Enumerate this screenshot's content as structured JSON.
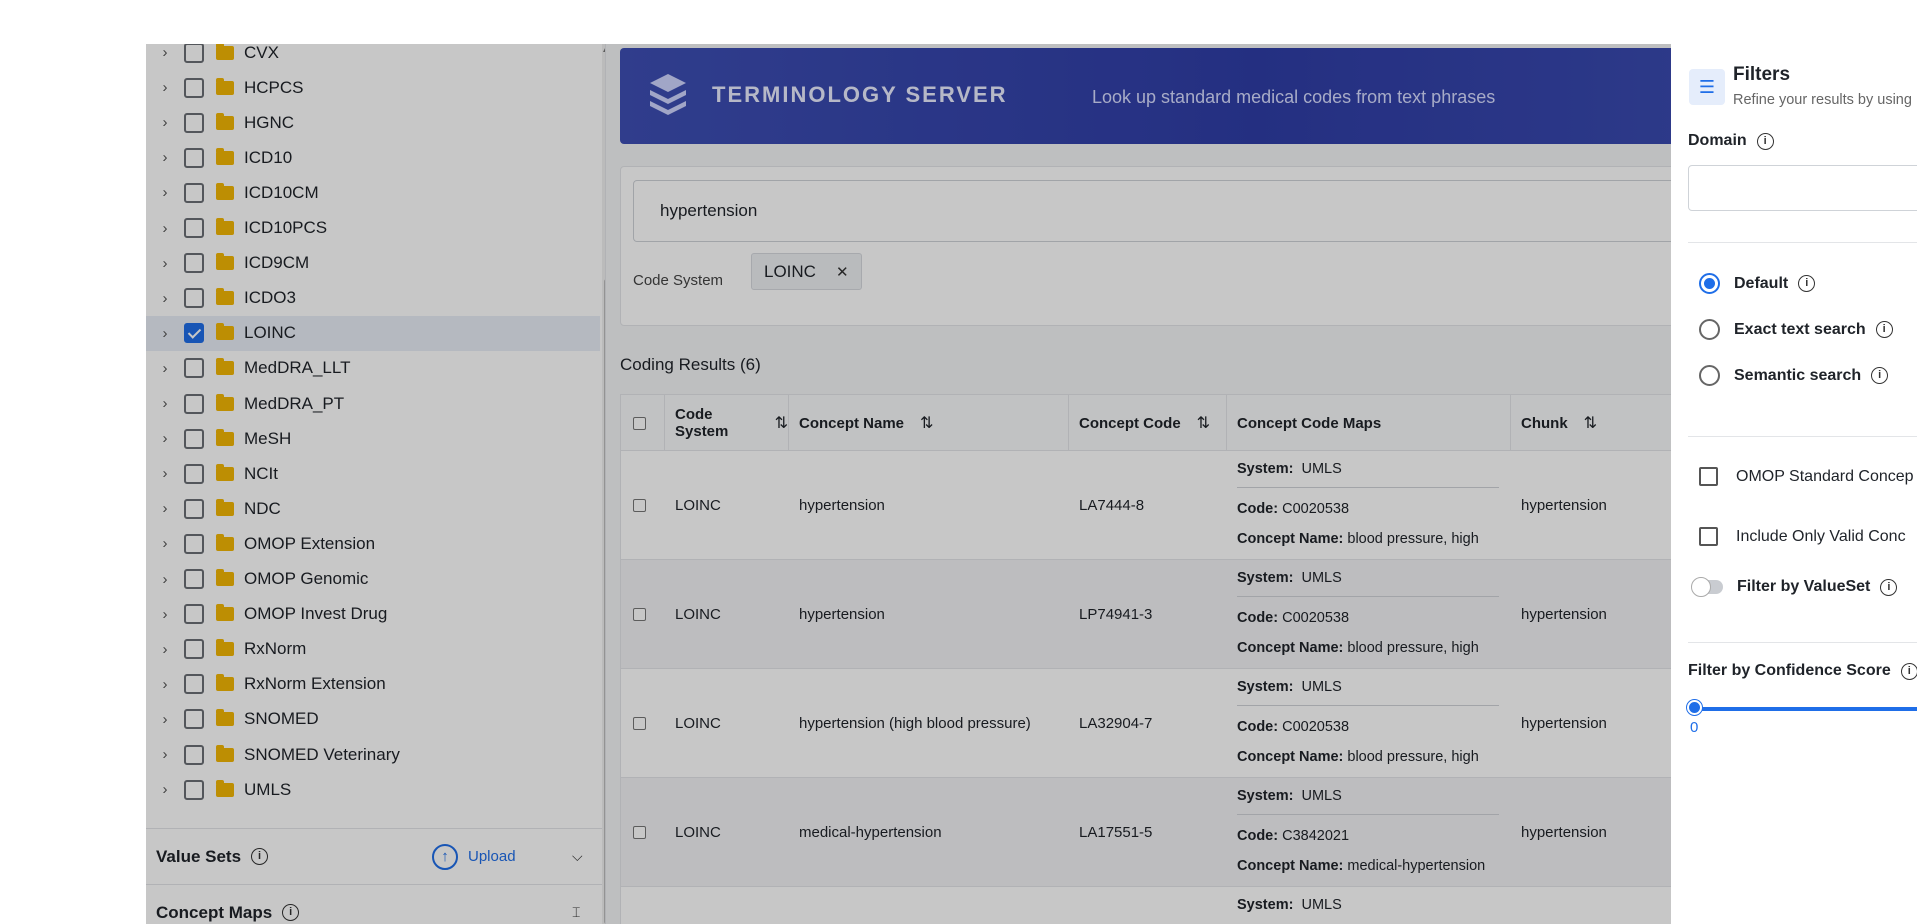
{
  "tree": {
    "items": [
      {
        "label": "CVX",
        "checked": false
      },
      {
        "label": "HCPCS",
        "checked": false
      },
      {
        "label": "HGNC",
        "checked": false
      },
      {
        "label": "ICD10",
        "checked": false
      },
      {
        "label": "ICD10CM",
        "checked": false
      },
      {
        "label": "ICD10PCS",
        "checked": false
      },
      {
        "label": "ICD9CM",
        "checked": false
      },
      {
        "label": "ICDO3",
        "checked": false
      },
      {
        "label": "LOINC",
        "checked": true
      },
      {
        "label": "MedDRA_LLT",
        "checked": false
      },
      {
        "label": "MedDRA_PT",
        "checked": false
      },
      {
        "label": "MeSH",
        "checked": false
      },
      {
        "label": "NCIt",
        "checked": false
      },
      {
        "label": "NDC",
        "checked": false
      },
      {
        "label": "OMOP Extension",
        "checked": false
      },
      {
        "label": "OMOP Genomic",
        "checked": false
      },
      {
        "label": "OMOP Invest Drug",
        "checked": false
      },
      {
        "label": "RxNorm",
        "checked": false
      },
      {
        "label": "RxNorm Extension",
        "checked": false
      },
      {
        "label": "SNOMED",
        "checked": false
      },
      {
        "label": "SNOMED Veterinary",
        "checked": false
      },
      {
        "label": "UMLS",
        "checked": false
      }
    ],
    "value_sets": {
      "title": "Value Sets",
      "upload": "Upload"
    },
    "concept_maps": {
      "title": "Concept Maps"
    },
    "partial_item": "LOINC"
  },
  "banner": {
    "title": "TERMINOLOGY SERVER",
    "subtitle": "Look up standard medical codes from text phrases"
  },
  "search": {
    "value": "hypertension",
    "code_system_label": "Code System",
    "chip": "LOINC"
  },
  "results": {
    "title": "Coding Results (6)",
    "headers": {
      "code_system": "Code System",
      "concept_name": "Concept Name",
      "concept_code": "Concept Code",
      "maps": "Concept Code Maps",
      "chunk": "Chunk"
    },
    "map_labels": {
      "system": "System:",
      "code": "Code:",
      "concept_name": "Concept Name:"
    },
    "rows": [
      {
        "code_system": "LOINC",
        "concept_name": "hypertension",
        "concept_code": "LA7444-8",
        "map_system": "UMLS",
        "map_code": "C0020538",
        "map_name": "blood pressure, high",
        "chunk": "hypertension"
      },
      {
        "code_system": "LOINC",
        "concept_name": "hypertension",
        "concept_code": "LP74941-3",
        "map_system": "UMLS",
        "map_code": "C0020538",
        "map_name": "blood pressure, high",
        "chunk": "hypertension"
      },
      {
        "code_system": "LOINC",
        "concept_name": "hypertension (high blood pressure)",
        "concept_code": "LA32904-7",
        "map_system": "UMLS",
        "map_code": "C0020538",
        "map_name": "blood pressure, high",
        "chunk": "hypertension"
      },
      {
        "code_system": "LOINC",
        "concept_name": "medical-hypertension",
        "concept_code": "LA17551-5",
        "map_system": "UMLS",
        "map_code": "C3842021",
        "map_name": "medical-hypertension",
        "chunk": "hypertension"
      }
    ],
    "partial_map_system": "UMLS"
  },
  "filters": {
    "title": "Filters",
    "subtitle": "Refine your results by using",
    "domain_label": "Domain",
    "search_modes": [
      "Default",
      "Exact text search",
      "Semantic search"
    ],
    "selected_mode": "Default",
    "omop_label": "OMOP Standard Concep",
    "valid_label": "Include Only Valid Conc",
    "valueset_label": "Filter by ValueSet",
    "confidence_label": "Filter by Confidence Score",
    "confidence_value": "0"
  },
  "colors": {
    "accent": "#1f6ee8",
    "banner": "#3e4fb4",
    "folder": "#f2b705"
  }
}
